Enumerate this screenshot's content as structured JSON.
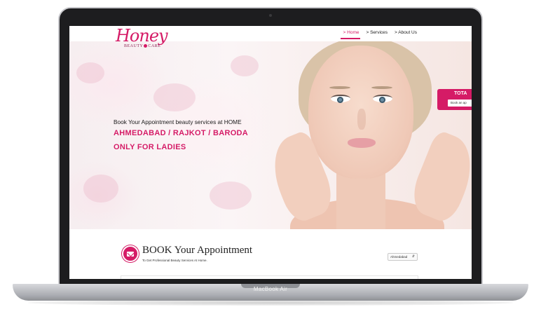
{
  "device": {
    "label": "MacBook Air"
  },
  "logo": {
    "main": "Honey",
    "sub_left": "BEAUTY",
    "sub_right": "CARE"
  },
  "nav": {
    "items": [
      {
        "label": "> Home",
        "active": true
      },
      {
        "label": "> Services",
        "active": false
      },
      {
        "label": "> About Us",
        "active": false
      }
    ]
  },
  "hero": {
    "line1": "Book Your Appointment beauty services at HOME",
    "line2": "AHMEDABAD / RAJKOT / BARODA",
    "line3": "ONLY FOR LADIES"
  },
  "total_card": {
    "label": "TOTA",
    "button": "Book an ap"
  },
  "booking": {
    "title": "BOOK Your Appointment",
    "subtitle": "To Get Professional Beauty Services At Home.",
    "city_selected": "Ahmedabad"
  },
  "colors": {
    "brand": "#d51b66",
    "laptop_frame": "#1d1d1f"
  },
  "icons": {
    "booking": "envelope-icon",
    "select": "up-down-caret-icon"
  }
}
